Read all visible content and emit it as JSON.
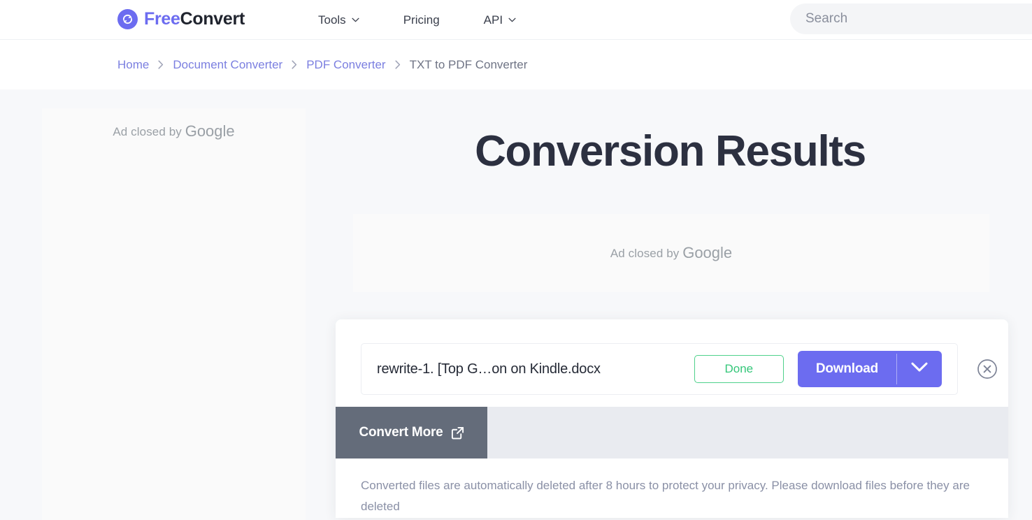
{
  "header": {
    "brand": {
      "part1": "Free",
      "part2": "Convert",
      "icon": "refresh-circle-icon"
    },
    "nav": [
      {
        "label": "Tools",
        "has_caret": true
      },
      {
        "label": "Pricing",
        "has_caret": false
      },
      {
        "label": "API",
        "has_caret": true
      }
    ],
    "search": {
      "value": "",
      "placeholder": "Search"
    }
  },
  "breadcrumb": {
    "items": [
      {
        "label": "Home",
        "current": false
      },
      {
        "label": "Document Converter",
        "current": false
      },
      {
        "label": "PDF Converter",
        "current": false
      },
      {
        "label": "TXT to PDF Converter",
        "current": true
      }
    ]
  },
  "ads": {
    "left": {
      "text_prefix": "Ad closed by ",
      "brand": "Google"
    },
    "top": {
      "text_prefix": "Ad closed by ",
      "brand": "Google"
    }
  },
  "main": {
    "title": "Conversion Results",
    "file": {
      "name": "rewrite-1. [Top G…on on Kindle.docx",
      "status_label": "Done",
      "download_label": "Download",
      "caret_icon": "chevron-down-icon",
      "close_icon": "close-circle-icon"
    },
    "convert_more_label": "Convert More",
    "convert_more_icon": "external-link-icon",
    "disclaimer": "Converted files are automatically deleted after 8 hours to protect your privacy. Please download files before they are deleted"
  },
  "colors": {
    "brand_purple": "#6c6cf0",
    "success_green": "#35c77a",
    "title_navy": "#2c3040",
    "convert_more_gray": "#646c7a",
    "page_bg": "#f7f8fa"
  }
}
